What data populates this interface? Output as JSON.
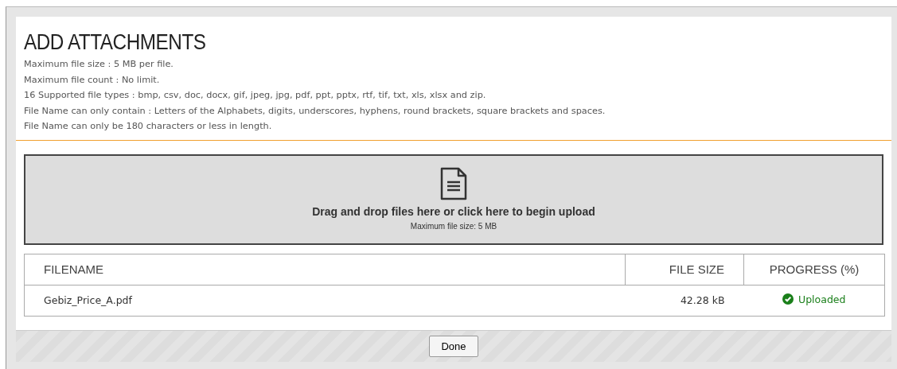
{
  "dialog": {
    "title": "ADD ATTACHMENTS",
    "rules": [
      "Maximum file size : 5 MB per file.",
      "Maximum file count : No limit.",
      "16 Supported file types : bmp, csv, doc, docx, gif, jpeg, jpg, pdf, ppt, pptx, rtf, tif, txt, xls, xlsx and zip.",
      "File Name can only contain : Letters of the Alphabets, digits, underscores, hyphens, round brackets, square brackets and spaces.",
      "File Name can only be 180 characters or less in length."
    ]
  },
  "dropzone": {
    "label": "Drag and drop files here or click here to begin upload",
    "hint": "Maximum file size: 5 MB"
  },
  "table": {
    "columns": [
      "FILENAME",
      "FILE SIZE",
      "PROGRESS (%)"
    ],
    "rows": [
      {
        "filename": "Gebiz_Price_A.pdf",
        "size": "42.28 kB",
        "status": {
          "kind": "uploaded",
          "text": "Uploaded"
        }
      }
    ]
  },
  "buttons": [
    "Done"
  ]
}
